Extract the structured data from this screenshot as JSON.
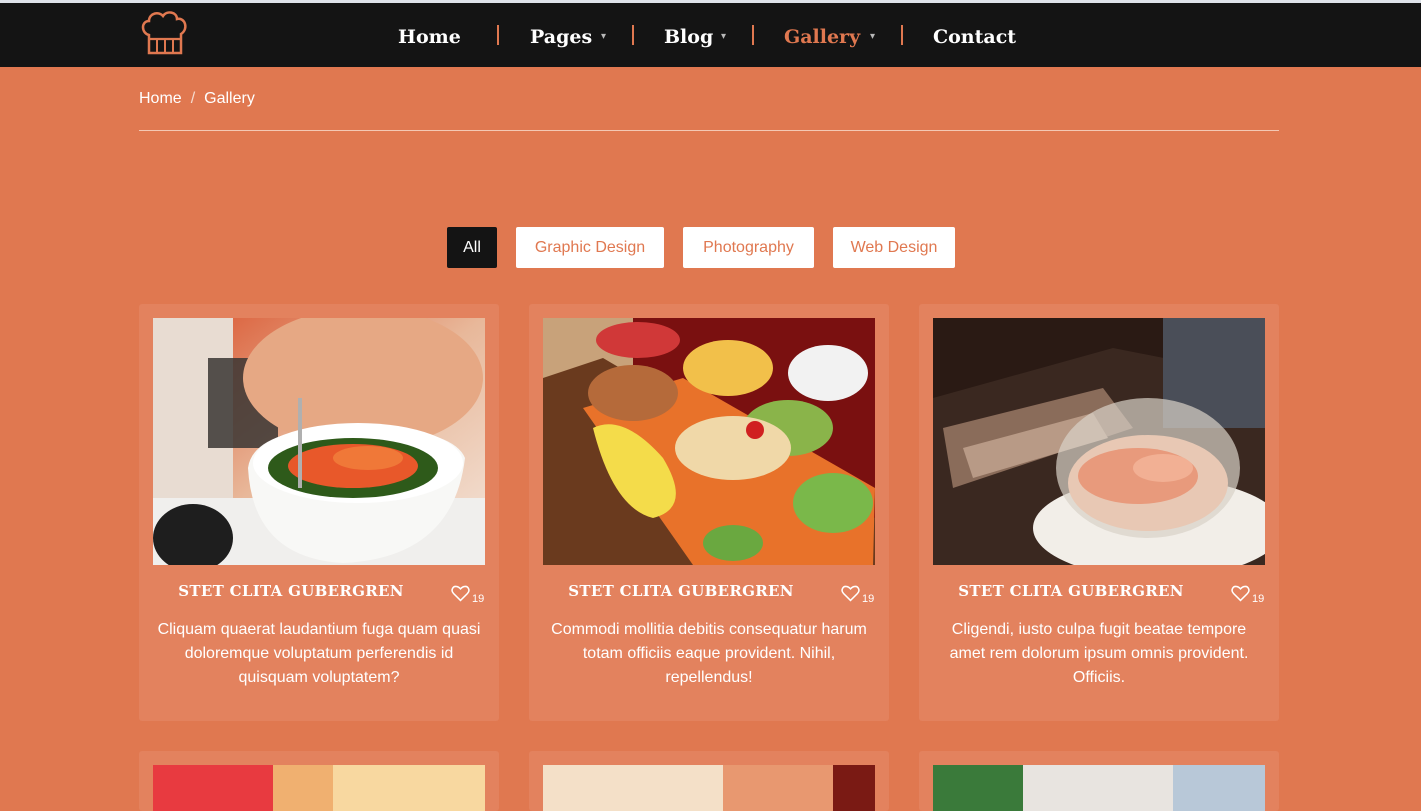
{
  "nav": {
    "logo_icon": "chef-hat-icon",
    "items": [
      {
        "label": "Home"
      },
      {
        "label": "Pages"
      },
      {
        "label": "Blog"
      },
      {
        "label": "Gallery"
      },
      {
        "label": "Contact"
      }
    ]
  },
  "breadcrumb": {
    "home": "Home",
    "separator": "/",
    "current": "Gallery"
  },
  "filters": [
    "All",
    "Graphic Design",
    "Photography",
    "Web Design"
  ],
  "cards": [
    {
      "title": "STET CLITA GUBERGREN",
      "likes": "19",
      "text": "Cliquam quaerat laudantium fuga quam quasi doloremque voluptatum perferendis id quisquam voluptatem?"
    },
    {
      "title": "STET CLITA GUBERGREN",
      "likes": "19",
      "text": "Commodi mollitia debitis consequatur harum totam officiis eaque provident. Nihil, repellendus!"
    },
    {
      "title": "STET CLITA GUBERGREN",
      "likes": "19",
      "text": "Cligendi, iusto culpa fugit beatae tempore amet rem dolorum ipsum omnis provident. Officiis."
    }
  ],
  "colors": {
    "accent": "#e07850",
    "navbar": "#141414",
    "card": "#e3825e",
    "active_filter": "#141414"
  }
}
